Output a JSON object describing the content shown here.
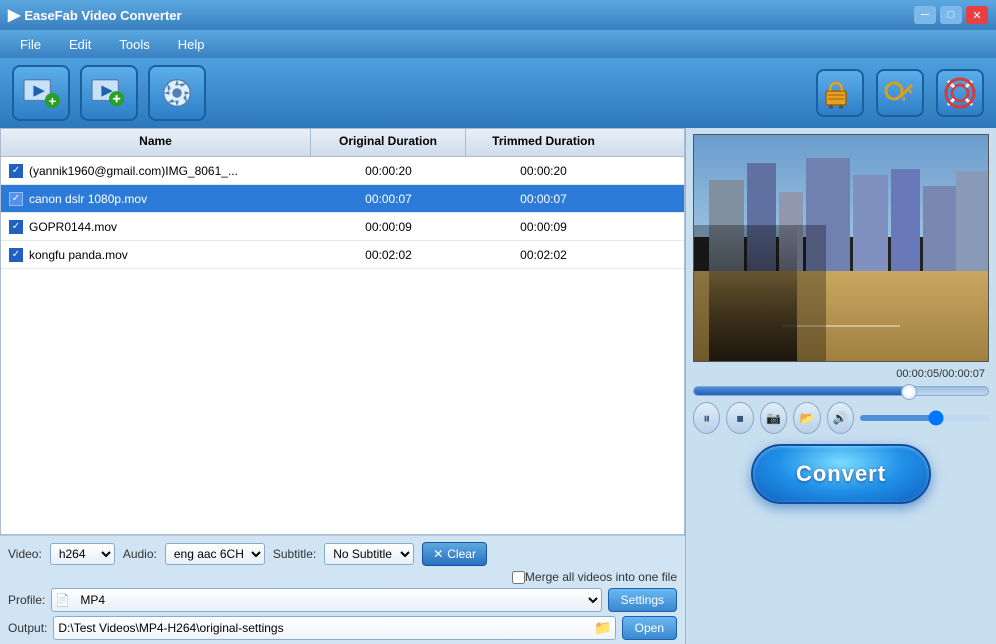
{
  "app": {
    "title": "EaseFab Video Converter",
    "icon": "▶"
  },
  "window_controls": {
    "minimize": "─",
    "maximize": "□",
    "close": "✕"
  },
  "menu": {
    "items": [
      "File",
      "Edit",
      "Tools",
      "Help"
    ]
  },
  "toolbar": {
    "add_video_label": "Add Video",
    "edit_video_label": "Edit Video",
    "settings_label": "Settings",
    "buy_label": "Buy",
    "key_label": "Key",
    "help_label": "Help"
  },
  "file_list": {
    "columns": [
      "Name",
      "Original Duration",
      "Trimmed Duration"
    ],
    "rows": [
      {
        "name": "(yannik1960@gmail.com)IMG_8061_...",
        "orig": "00:00:20",
        "trim": "00:00:20",
        "checked": true,
        "selected": false
      },
      {
        "name": "canon dslr 1080p.mov",
        "orig": "00:00:07",
        "trim": "00:00:07",
        "checked": true,
        "selected": true
      },
      {
        "name": "GOPR0144.mov",
        "orig": "00:00:09",
        "trim": "00:00:09",
        "checked": true,
        "selected": false
      },
      {
        "name": "kongfu panda.mov",
        "orig": "00:02:02",
        "trim": "00:02:02",
        "checked": true,
        "selected": false
      }
    ]
  },
  "controls": {
    "video_label": "Video:",
    "video_value": "h264",
    "audio_label": "Audio:",
    "audio_value": "eng aac 6CH",
    "subtitle_label": "Subtitle:",
    "subtitle_value": "No Subtitle",
    "clear_label": "Clear",
    "merge_label": "Merge all videos into one file",
    "profile_label": "Profile:",
    "profile_value": "MP4",
    "settings_label": "Settings",
    "output_label": "Output:",
    "output_value": "D:\\Test Videos\\MP4-H264\\original-settings",
    "open_label": "Open"
  },
  "preview": {
    "time_current": "00:00:05",
    "time_total": "00:00:07",
    "time_display": "00:00:05/00:00:07",
    "progress_pct": 73
  },
  "convert": {
    "label": "Convert"
  }
}
